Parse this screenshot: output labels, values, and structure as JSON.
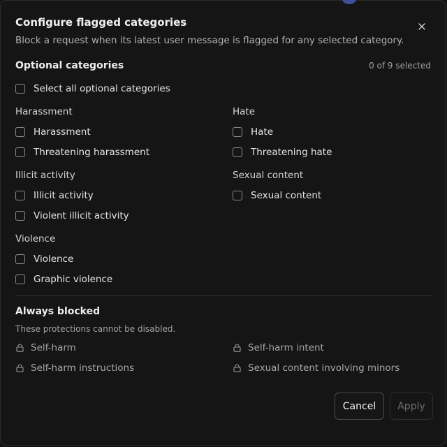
{
  "dialog": {
    "title": "Configure flagged categories",
    "subtitle": "Block a request when its latest user message is flagged for any selected category."
  },
  "optional": {
    "title": "Optional categories",
    "selected_count": "0 of 9 selected",
    "select_all_label": "Select all optional categories",
    "groups": {
      "harassment": {
        "label": "Harassment",
        "items": [
          "Harassment",
          "Threatening harassment"
        ]
      },
      "hate": {
        "label": "Hate",
        "items": [
          "Hate",
          "Threatening hate"
        ]
      },
      "illicit": {
        "label": "Illicit activity",
        "items": [
          "Illicit activity",
          "Violent illicit activity"
        ]
      },
      "sexual": {
        "label": "Sexual content",
        "items": [
          "Sexual content"
        ]
      },
      "violence": {
        "label": "Violence",
        "items": [
          "Violence",
          "Graphic violence"
        ]
      }
    }
  },
  "always_blocked": {
    "title": "Always blocked",
    "note": "These protections cannot be disabled.",
    "items": [
      "Self-harm",
      "Self-harm intent",
      "Self-harm instructions",
      "Sexual content involving minors"
    ]
  },
  "buttons": {
    "cancel": "Cancel",
    "apply": "Apply"
  },
  "icons": {
    "close": "close-icon",
    "lock": "lock-icon"
  }
}
